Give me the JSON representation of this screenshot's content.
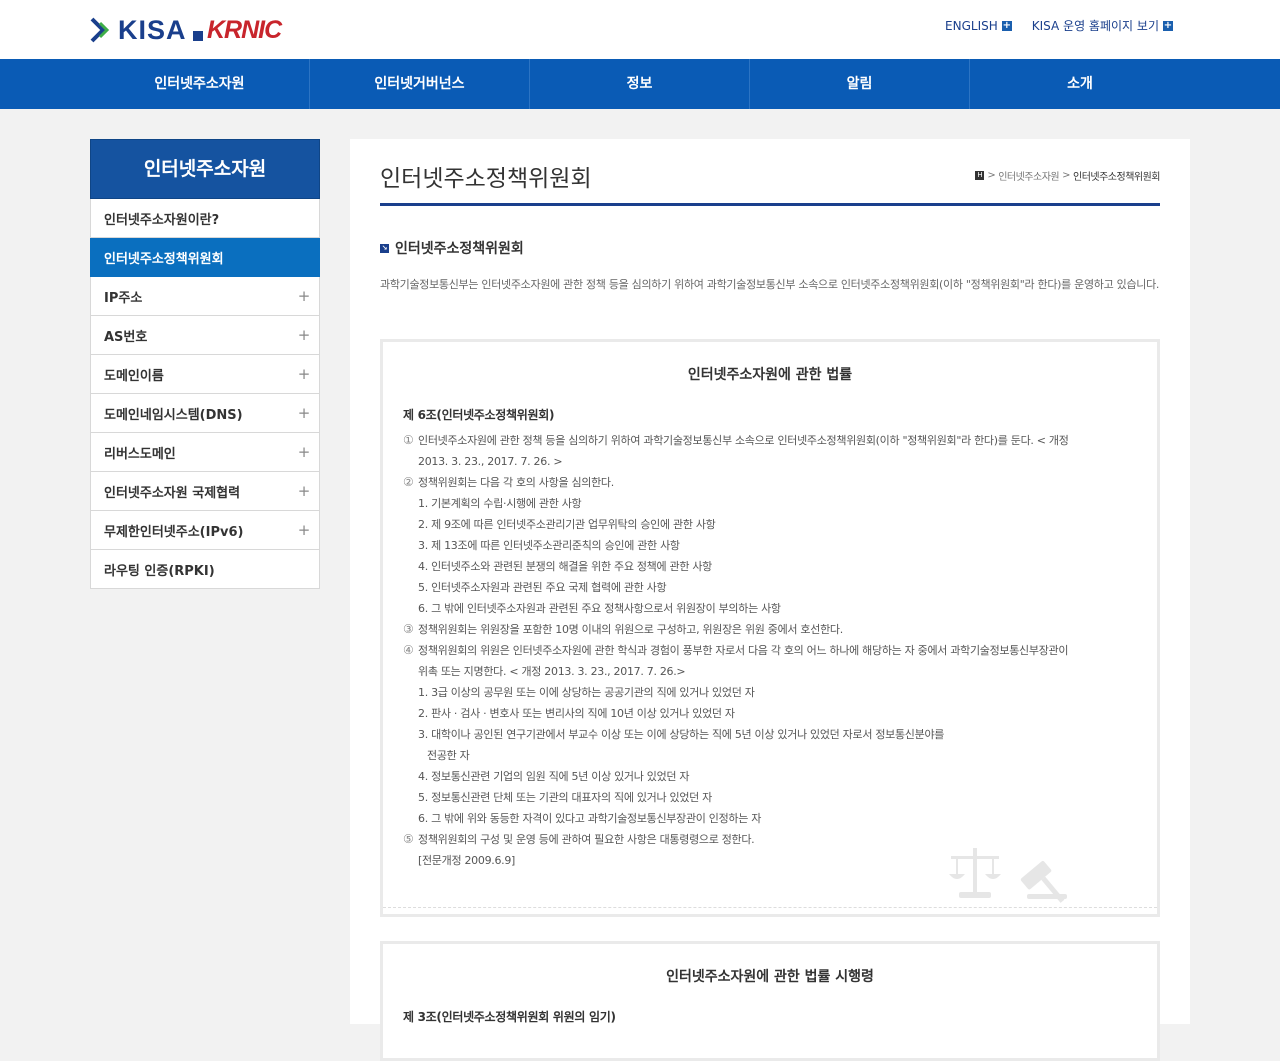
{
  "header": {
    "logo_kisa": "KISA",
    "logo_krnic": "KRNIC",
    "links": [
      "ENGLISH",
      "KISA 운영 홈페이지 보기"
    ]
  },
  "gnb": [
    "인터넷주소자원",
    "인터넷거버넌스",
    "정보",
    "알림",
    "소개"
  ],
  "lnb": {
    "title": "인터넷주소자원",
    "items": [
      {
        "label": "인터넷주소자원이란?",
        "plus": false,
        "active": false
      },
      {
        "label": "인터넷주소정책위원회",
        "plus": false,
        "active": true
      },
      {
        "label": "IP주소",
        "plus": true,
        "active": false
      },
      {
        "label": "AS번호",
        "plus": true,
        "active": false
      },
      {
        "label": "도메인이름",
        "plus": true,
        "active": false
      },
      {
        "label": "도메인네임시스템(DNS)",
        "plus": true,
        "active": false
      },
      {
        "label": "리버스도메인",
        "plus": true,
        "active": false
      },
      {
        "label": "인터넷주소자원 국제협력",
        "plus": true,
        "active": false
      },
      {
        "label": "무제한인터넷주소(IPv6)",
        "plus": true,
        "active": false
      },
      {
        "label": "라우팅 인증(RPKI)",
        "plus": false,
        "active": false
      }
    ],
    "plus_symbol": "+"
  },
  "content": {
    "page_title": "인터넷주소정책위원회",
    "breadcrumb": {
      "home": "H",
      "sep": ">",
      "parent": "인터넷주소자원",
      "current": "인터넷주소정책위원회"
    },
    "sub_title": "인터넷주소정책위원회",
    "sub_bullet": "↘",
    "desc": "과학기술정보통신부는 인터넷주소자원에 관한 정책 등을 심의하기 위하여 과학기술정보통신부 소속으로 인터넷주소정책위원회(이하 \"정책위원회\"라 한다)를 운영하고 있습니다."
  },
  "law1": {
    "heading": "인터넷주소자원에 관한 법률",
    "article": "제 6조(인터넷주소정책위원회)",
    "lines": [
      {
        "num": "①",
        "text": "인터넷주소자원에 관한 정책 등을 심의하기 위하여 과학기술정보통신부 소속으로 인터넷주소정책위원회(이하 \"정책위원회\"라 한다)를 둔다. < 개정",
        "indent": 0
      },
      {
        "num": "",
        "text": "2013. 3. 23., 2017. 7. 26. >",
        "indent": 1
      },
      {
        "num": "②",
        "text": "정책위원회는 다음 각 호의 사항을 심의한다.",
        "indent": 0
      },
      {
        "num": "",
        "text": "1. 기본계획의 수립·시행에 관한 사항",
        "indent": 1
      },
      {
        "num": "",
        "text": "2. 제 9조에 따른 인터넷주소관리기관 업무위탁의 승인에 관한 사항",
        "indent": 1
      },
      {
        "num": "",
        "text": "3. 제 13조에 따른 인터넷주소관리준칙의 승인에 관한 사항",
        "indent": 1
      },
      {
        "num": "",
        "text": "4. 인터넷주소와 관련된 분쟁의 해결을 위한 주요 정책에 관한 사항",
        "indent": 1
      },
      {
        "num": "",
        "text": "5. 인터넷주소자원과 관련된 주요 국제 협력에 관한 사항",
        "indent": 1
      },
      {
        "num": "",
        "text": "6. 그 밖에 인터넷주소자원과 관련된 주요 정책사항으로서 위원장이 부의하는 사항",
        "indent": 1
      },
      {
        "num": "③",
        "text": "정책위원회는 위원장을 포함한 10명 이내의 위원으로 구성하고, 위원장은 위원 중에서 호선한다.",
        "indent": 0
      },
      {
        "num": "④",
        "text": "정책위원회의 위원은 인터넷주소자원에 관한 학식과 경험이 풍부한 자로서 다음 각 호의 어느 하나에 해당하는 자 중에서 과학기술정보통신부장관이",
        "indent": 0
      },
      {
        "num": "",
        "text": "위촉 또는 지명한다. < 개정 2013. 3. 23., 2017. 7. 26.>",
        "indent": 1
      },
      {
        "num": "",
        "text": "1. 3급 이상의 공무원 또는 이에 상당하는 공공기관의 직에 있거나 있었던 자",
        "indent": 1
      },
      {
        "num": "",
        "text": "2. 판사 · 검사 · 변호사 또는 변리사의 직에 10년 이상 있거나 있었던 자",
        "indent": 1
      },
      {
        "num": "",
        "text": "3. 대학이나 공인된 연구기관에서 부교수 이상 또는 이에 상당하는 직에 5년 이상 있거나 있었던 자로서 정보통신분야를",
        "indent": 1
      },
      {
        "num": "",
        "text": "전공한 자",
        "indent": 2
      },
      {
        "num": "",
        "text": "4. 정보통신관련 기업의 임원 직에 5년 이상 있거나 있었던 자",
        "indent": 1
      },
      {
        "num": "",
        "text": "5. 정보통신관련 단체 또는 기관의 대표자의 직에 있거나 있었던 자",
        "indent": 1
      },
      {
        "num": "",
        "text": "6. 그 밖에 위와 동등한 자격이 있다고 과학기술정보통신부장관이 인정하는 자",
        "indent": 1
      },
      {
        "num": "⑤",
        "text": "정책위원회의 구성 및 운영 등에 관하여 필요한 사항은 대통령령으로 정한다.",
        "indent": 0
      },
      {
        "num": "",
        "text": "[전문개정 2009.6.9]",
        "indent": 1
      }
    ]
  },
  "law2": {
    "heading": "인터넷주소자원에 관한 법률 시행령",
    "article": "제 3조(인터넷주소정책위원회 위원의 임기)"
  }
}
